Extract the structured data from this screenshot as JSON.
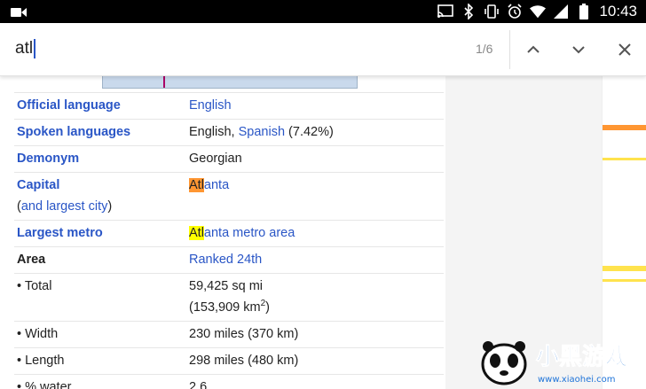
{
  "status_bar": {
    "time": "10:43",
    "icons": [
      "video-icon",
      "cast-icon",
      "bluetooth-icon",
      "vibrate-icon",
      "alarm-icon",
      "wifi-icon",
      "signal-icon",
      "battery-icon"
    ]
  },
  "find_bar": {
    "query": "atl",
    "count": "1/6"
  },
  "infobox": {
    "official_language": {
      "label": "Official language",
      "value": "English"
    },
    "spoken_languages": {
      "label": "Spoken languages",
      "value_a": "English, ",
      "value_link": "Spanish",
      "value_b": " (7.42%)"
    },
    "demonym": {
      "label": "Demonym",
      "value": "Georgian"
    },
    "capital": {
      "label": "Capital",
      "sublabel": "(and largest city)",
      "sublabel_open": "(",
      "sublabel_link": "and largest city",
      "sublabel_close": ")",
      "match": "Atl",
      "rest": "anta"
    },
    "largest_metro": {
      "label": "Largest metro",
      "match": "Atl",
      "rest": "anta metro area"
    },
    "area": {
      "label": "Area",
      "value": "Ranked 24th"
    },
    "total": {
      "label": "• Total",
      "value_line1": "59,425 sq mi",
      "value_line2a": "(153,909 km",
      "value_sup": "2",
      "value_line2b": ")"
    },
    "width": {
      "label": "• Width",
      "value": "230 miles (370 km)"
    },
    "length": {
      "label": "• Length",
      "value": "298 miles (480 km)"
    },
    "water": {
      "label": "• % water",
      "value": "2.6"
    }
  },
  "colors": {
    "link": "#2a56c6",
    "current_match": "#ff9632",
    "other_match": "#ffff00"
  },
  "watermark": {
    "text": "小黑游戏",
    "url": "www.xiaohei.com"
  }
}
